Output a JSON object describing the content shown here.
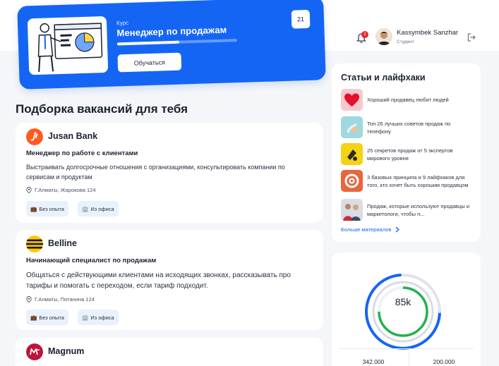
{
  "course": {
    "kicker": "Курс",
    "title": "Менеджер по продажам",
    "progress": 0.52,
    "button": "Обучаться",
    "badge": "21"
  },
  "header": {
    "notifications": "2",
    "user_name": "Kassymbek Sanzhar",
    "user_role": "Студент"
  },
  "vacancies": {
    "title": "Подборка вакансий для тебя",
    "items": [
      {
        "company": "Jusan Bank",
        "position": "Менеджер по работе с клиентами",
        "description": "Выстраивать долгосрочные отношения с организациями, консультировать компании по сервисам и продуктам",
        "address": "Г.Алматы, Жарокова 124",
        "tags": [
          "Без опыта",
          "Из офиса"
        ]
      },
      {
        "company": "Belline",
        "position": "Начинающий специалист по продажам",
        "description": "Общаться с действующими клиентами на исходящих звонках, рассказывать про тарифы и помогать с переходом, если тариф подходит.",
        "address": "Г.Алматы, Потанина 124",
        "tags": [
          "Без опыта",
          "Из офиса"
        ]
      },
      {
        "company": "Magnum"
      }
    ]
  },
  "articles": {
    "title": "Статьи и лайфхаки",
    "items": [
      "Хороший продавец любит людей",
      "Топ 26 лучших советов продаж по телефону",
      "25 секретов продаж от 5 экспертов мирового уровня",
      "3 базовых принципа и 9 лайфхаков для того, кто хочет быть хорошим продавцом",
      "Продаж, которые используют продавцы и маркетологи, чтобы п..."
    ],
    "more": "Больше материалов"
  },
  "stats": {
    "center_value": "85k",
    "value_a": "342.000",
    "value_b": "200.000"
  },
  "colors": {
    "primary": "#1565f5",
    "green": "#22b14c",
    "badge_red": "#e8262b"
  }
}
